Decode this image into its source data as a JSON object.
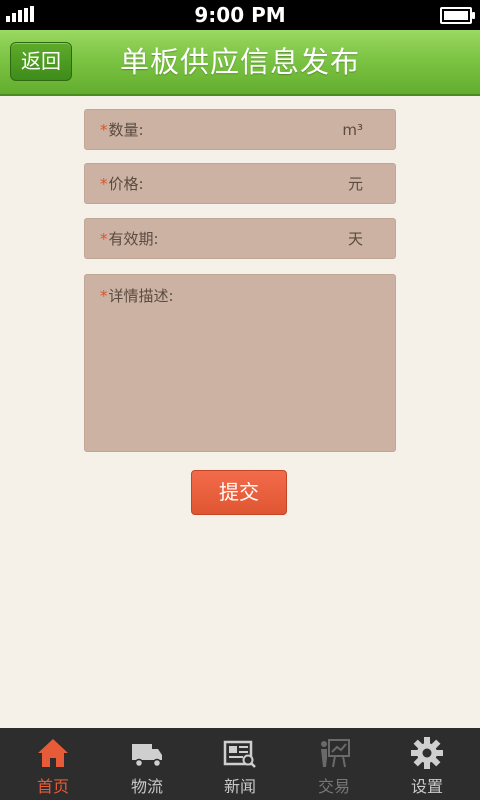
{
  "status": {
    "time": "9:00 PM"
  },
  "header": {
    "back_label": "返回",
    "title": "单板供应信息发布"
  },
  "form": {
    "required_mark": "*",
    "quantity": {
      "label": "数量:",
      "unit": "m³"
    },
    "price": {
      "label": "价格:",
      "unit": "元"
    },
    "validity": {
      "label": "有效期:",
      "unit": "天"
    },
    "description": {
      "label": "详情描述:"
    },
    "submit_label": "提交"
  },
  "tabs": [
    {
      "label": "首页",
      "icon": "home-icon",
      "active": true
    },
    {
      "label": "物流",
      "icon": "truck-icon"
    },
    {
      "label": "新闻",
      "icon": "newspaper-icon"
    },
    {
      "label": "交易",
      "icon": "trade-icon",
      "disabled": true
    },
    {
      "label": "设置",
      "icon": "gear-icon"
    }
  ],
  "colors": {
    "accent": "#e85b38",
    "header_green": "#7cc443",
    "field_bg": "#cbb2a2",
    "page_bg": "#f6f1e8"
  }
}
